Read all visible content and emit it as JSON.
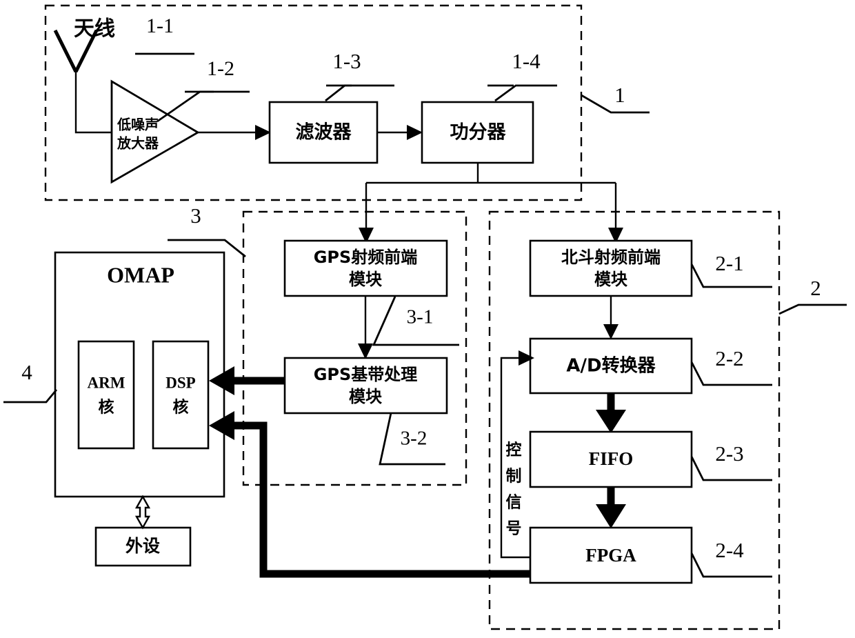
{
  "diagram": {
    "title_text_language": "zh",
    "colors": {
      "line": "#000000",
      "fill": "#ffffff",
      "background": "#ffffff"
    },
    "groups": [
      {
        "id": "rf-frontend-group",
        "callout": "1"
      },
      {
        "id": "beidou-group",
        "callout": "2"
      },
      {
        "id": "gps-group",
        "callout": "3"
      },
      {
        "id": "omap-group",
        "callout": "4"
      }
    ],
    "antenna": {
      "label": "天线",
      "callout": "1-1"
    },
    "blocks": {
      "lna": {
        "label_line1": "低噪声",
        "label_line2": "放大器",
        "callout": "1-2"
      },
      "filter": {
        "label": "滤波器",
        "callout": "1-3"
      },
      "power_divider": {
        "label": "功分器",
        "callout": "1-4"
      },
      "gps_rf": {
        "label_line1": "GPS射频前端",
        "label_line2": "模块",
        "callout": "3-1"
      },
      "gps_baseband": {
        "label_line1": "GPS基带处理",
        "label_line2": "模块",
        "callout": "3-2"
      },
      "beidou_rf": {
        "label_line1": "北斗射频前端",
        "label_line2": "模块",
        "callout": "2-1"
      },
      "adc": {
        "label": "A/D转换器",
        "callout": "2-2"
      },
      "fifo": {
        "label": "FIFO",
        "callout": "2-3"
      },
      "fpga": {
        "label": "FPGA",
        "callout": "2-4"
      },
      "omap": {
        "label": "OMAP"
      },
      "arm_core": {
        "label_line1": "ARM",
        "label_line2": "核"
      },
      "dsp_core": {
        "label_line1": "DSP",
        "label_line2": "核"
      },
      "peripheral": {
        "label": "外设"
      }
    },
    "signals": {
      "control_signal": {
        "label_chars": [
          "控",
          "制",
          "信",
          "号"
        ],
        "label": "控制信号"
      }
    }
  }
}
